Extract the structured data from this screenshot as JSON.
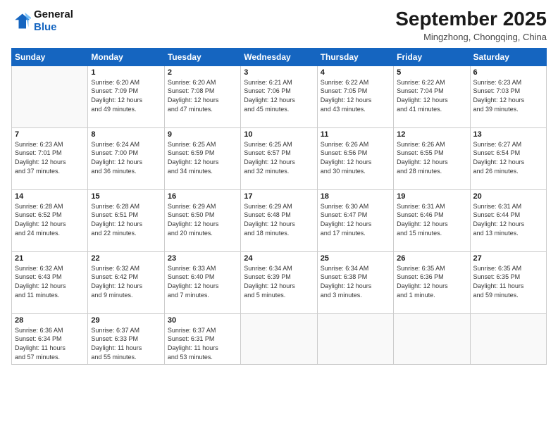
{
  "header": {
    "logo_line1": "General",
    "logo_line2": "Blue",
    "month": "September 2025",
    "location": "Mingzhong, Chongqing, China"
  },
  "weekdays": [
    "Sunday",
    "Monday",
    "Tuesday",
    "Wednesday",
    "Thursday",
    "Friday",
    "Saturday"
  ],
  "weeks": [
    [
      {
        "day": "",
        "info": ""
      },
      {
        "day": "1",
        "info": "Sunrise: 6:20 AM\nSunset: 7:09 PM\nDaylight: 12 hours\nand 49 minutes."
      },
      {
        "day": "2",
        "info": "Sunrise: 6:20 AM\nSunset: 7:08 PM\nDaylight: 12 hours\nand 47 minutes."
      },
      {
        "day": "3",
        "info": "Sunrise: 6:21 AM\nSunset: 7:06 PM\nDaylight: 12 hours\nand 45 minutes."
      },
      {
        "day": "4",
        "info": "Sunrise: 6:22 AM\nSunset: 7:05 PM\nDaylight: 12 hours\nand 43 minutes."
      },
      {
        "day": "5",
        "info": "Sunrise: 6:22 AM\nSunset: 7:04 PM\nDaylight: 12 hours\nand 41 minutes."
      },
      {
        "day": "6",
        "info": "Sunrise: 6:23 AM\nSunset: 7:03 PM\nDaylight: 12 hours\nand 39 minutes."
      }
    ],
    [
      {
        "day": "7",
        "info": "Sunrise: 6:23 AM\nSunset: 7:01 PM\nDaylight: 12 hours\nand 37 minutes."
      },
      {
        "day": "8",
        "info": "Sunrise: 6:24 AM\nSunset: 7:00 PM\nDaylight: 12 hours\nand 36 minutes."
      },
      {
        "day": "9",
        "info": "Sunrise: 6:25 AM\nSunset: 6:59 PM\nDaylight: 12 hours\nand 34 minutes."
      },
      {
        "day": "10",
        "info": "Sunrise: 6:25 AM\nSunset: 6:57 PM\nDaylight: 12 hours\nand 32 minutes."
      },
      {
        "day": "11",
        "info": "Sunrise: 6:26 AM\nSunset: 6:56 PM\nDaylight: 12 hours\nand 30 minutes."
      },
      {
        "day": "12",
        "info": "Sunrise: 6:26 AM\nSunset: 6:55 PM\nDaylight: 12 hours\nand 28 minutes."
      },
      {
        "day": "13",
        "info": "Sunrise: 6:27 AM\nSunset: 6:54 PM\nDaylight: 12 hours\nand 26 minutes."
      }
    ],
    [
      {
        "day": "14",
        "info": "Sunrise: 6:28 AM\nSunset: 6:52 PM\nDaylight: 12 hours\nand 24 minutes."
      },
      {
        "day": "15",
        "info": "Sunrise: 6:28 AM\nSunset: 6:51 PM\nDaylight: 12 hours\nand 22 minutes."
      },
      {
        "day": "16",
        "info": "Sunrise: 6:29 AM\nSunset: 6:50 PM\nDaylight: 12 hours\nand 20 minutes."
      },
      {
        "day": "17",
        "info": "Sunrise: 6:29 AM\nSunset: 6:48 PM\nDaylight: 12 hours\nand 18 minutes."
      },
      {
        "day": "18",
        "info": "Sunrise: 6:30 AM\nSunset: 6:47 PM\nDaylight: 12 hours\nand 17 minutes."
      },
      {
        "day": "19",
        "info": "Sunrise: 6:31 AM\nSunset: 6:46 PM\nDaylight: 12 hours\nand 15 minutes."
      },
      {
        "day": "20",
        "info": "Sunrise: 6:31 AM\nSunset: 6:44 PM\nDaylight: 12 hours\nand 13 minutes."
      }
    ],
    [
      {
        "day": "21",
        "info": "Sunrise: 6:32 AM\nSunset: 6:43 PM\nDaylight: 12 hours\nand 11 minutes."
      },
      {
        "day": "22",
        "info": "Sunrise: 6:32 AM\nSunset: 6:42 PM\nDaylight: 12 hours\nand 9 minutes."
      },
      {
        "day": "23",
        "info": "Sunrise: 6:33 AM\nSunset: 6:40 PM\nDaylight: 12 hours\nand 7 minutes."
      },
      {
        "day": "24",
        "info": "Sunrise: 6:34 AM\nSunset: 6:39 PM\nDaylight: 12 hours\nand 5 minutes."
      },
      {
        "day": "25",
        "info": "Sunrise: 6:34 AM\nSunset: 6:38 PM\nDaylight: 12 hours\nand 3 minutes."
      },
      {
        "day": "26",
        "info": "Sunrise: 6:35 AM\nSunset: 6:36 PM\nDaylight: 12 hours\nand 1 minute."
      },
      {
        "day": "27",
        "info": "Sunrise: 6:35 AM\nSunset: 6:35 PM\nDaylight: 11 hours\nand 59 minutes."
      }
    ],
    [
      {
        "day": "28",
        "info": "Sunrise: 6:36 AM\nSunset: 6:34 PM\nDaylight: 11 hours\nand 57 minutes."
      },
      {
        "day": "29",
        "info": "Sunrise: 6:37 AM\nSunset: 6:33 PM\nDaylight: 11 hours\nand 55 minutes."
      },
      {
        "day": "30",
        "info": "Sunrise: 6:37 AM\nSunset: 6:31 PM\nDaylight: 11 hours\nand 53 minutes."
      },
      {
        "day": "",
        "info": ""
      },
      {
        "day": "",
        "info": ""
      },
      {
        "day": "",
        "info": ""
      },
      {
        "day": "",
        "info": ""
      }
    ]
  ]
}
